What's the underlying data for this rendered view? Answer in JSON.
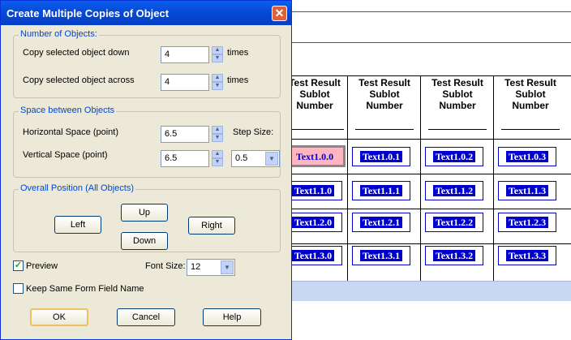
{
  "dialog": {
    "title": "Create Multiple Copies of Object",
    "number_group": {
      "legend": "Number of Objects:",
      "down_label": "Copy selected object down",
      "down_value": "4",
      "down_unit": "times",
      "across_label": "Copy selected object across",
      "across_value": "4",
      "across_unit": "times"
    },
    "space_group": {
      "legend": "Space between Objects",
      "horizontal_label": "Horizontal Space (point)",
      "horizontal_value": "6.5",
      "vertical_label": "Vertical Space (point)",
      "vertical_value": "6.5",
      "step_label": "Step Size:",
      "step_value": "0.5"
    },
    "position_group": {
      "legend": "Overall Position (All Objects)",
      "up": "Up",
      "left": "Left",
      "right": "Right",
      "down": "Down"
    },
    "preview_label": "Preview",
    "preview_checked": true,
    "font_size_label": "Font Size:",
    "font_size_value": "12",
    "keep_name_label": "Keep Same Form Field Name",
    "keep_name_checked": false,
    "ok": "OK",
    "cancel": "Cancel",
    "help": "Help"
  },
  "document": {
    "headers": [
      [
        "Test Result",
        "Sublot",
        "Number"
      ],
      [
        "Test Result",
        "Sublot",
        "Number"
      ],
      [
        "Test Result",
        "Sublot",
        "Number"
      ],
      [
        "Test Result",
        "Sublot",
        "Number"
      ]
    ],
    "cells": [
      [
        "Text1.0.0",
        "Text1.0.1",
        "Text1.0.2",
        "Text1.0.3"
      ],
      [
        "Text1.1.0",
        "Text1.1.1",
        "Text1.1.2",
        "Text1.1.3"
      ],
      [
        "Text1.2.0",
        "Text1.2.1",
        "Text1.2.2",
        "Text1.2.3"
      ],
      [
        "Text1.3.0",
        "Text1.3.1",
        "Text1.3.2",
        "Text1.3.3"
      ]
    ],
    "selected_cell": "Text1.0.0"
  }
}
